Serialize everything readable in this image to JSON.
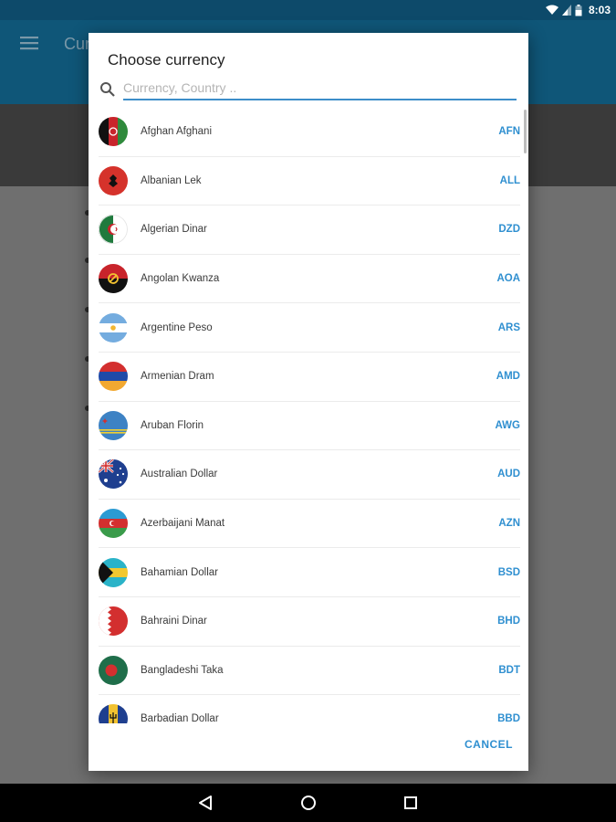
{
  "status_bar": {
    "time": "8:03"
  },
  "app": {
    "title": "Cur"
  },
  "dialog": {
    "title": "Choose currency",
    "search_placeholder": "Currency, Country ..",
    "cancel_label": "CANCEL",
    "items": [
      {
        "name": "Afghan Afghani",
        "code": "AFN"
      },
      {
        "name": "Albanian Lek",
        "code": "ALL"
      },
      {
        "name": "Algerian Dinar",
        "code": "DZD"
      },
      {
        "name": "Angolan Kwanza",
        "code": "AOA"
      },
      {
        "name": "Argentine Peso",
        "code": "ARS"
      },
      {
        "name": "Armenian Dram",
        "code": "AMD"
      },
      {
        "name": "Aruban Florin",
        "code": "AWG"
      },
      {
        "name": "Australian Dollar",
        "code": "AUD"
      },
      {
        "name": "Azerbaijani Manat",
        "code": "AZN"
      },
      {
        "name": "Bahamian Dollar",
        "code": "BSD"
      },
      {
        "name": "Bahraini Dinar",
        "code": "BHD"
      },
      {
        "name": "Bangladeshi Taka",
        "code": "BDT"
      },
      {
        "name": "Barbadian Dollar",
        "code": "BBD"
      }
    ]
  },
  "colors": {
    "accent": "#2f8fd0",
    "app_bar": "#0f5678",
    "status_bar": "#0d4a6a"
  },
  "icons": {
    "menu": "menu-icon",
    "search": "search-icon",
    "back": "back-triangle-icon",
    "home": "home-circle-icon",
    "recents": "recents-square-icon"
  }
}
